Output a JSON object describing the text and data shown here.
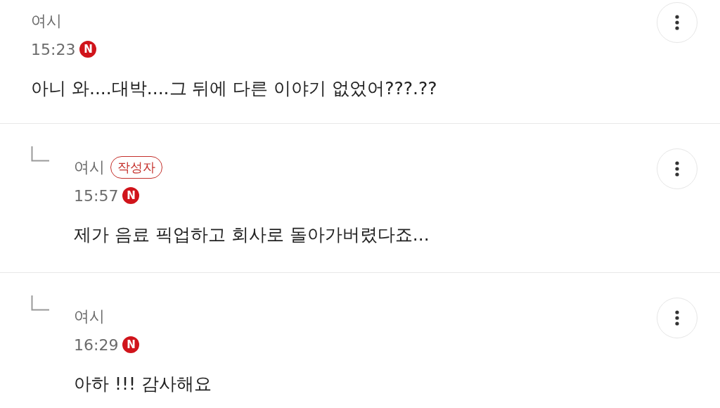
{
  "comments": [
    {
      "kind": "comment",
      "author": "여시",
      "time": "15:23",
      "badge": "N",
      "text": "아니 와....대박....그 뒤에 다른 이야기 없었어???.??"
    },
    {
      "kind": "reply",
      "author": "여시",
      "author_tag": "작성자",
      "time": "15:57",
      "badge": "N",
      "text": "제가 음료 픽업하고 회사로 돌아가버렸다죠..."
    },
    {
      "kind": "reply",
      "author": "여시",
      "time": "16:29",
      "badge": "N",
      "text": "아하 !!! 감사해요"
    }
  ]
}
